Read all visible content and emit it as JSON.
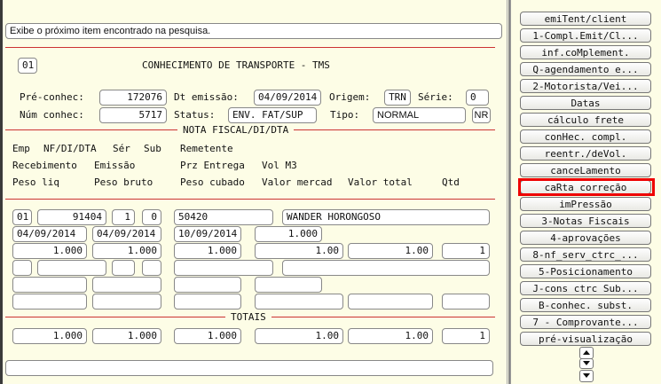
{
  "status_hint": "Exibe o próximo item encontrado na pesquisa.",
  "header": {
    "code": "01",
    "title": "CONHECIMENTO DE TRANSPORTE - TMS"
  },
  "doc": {
    "pre_conhec_label": "Pré-conhec:",
    "pre_conhec": "172076",
    "dt_emissao_label": "Dt emissão:",
    "dt_emissao": "04/09/2014",
    "origem_label": "Origem:",
    "origem": "TRN",
    "serie_label": "Série:",
    "serie": "0",
    "num_conhec_label": "Núm conhec:",
    "num_conhec": "5717",
    "status_label": "Status:",
    "status": "ENV. FAT/SUP",
    "tipo_label": "Tipo:",
    "tipo": "NORMAL",
    "tipo_code": "NR"
  },
  "nf_section": {
    "title": "NOTA FISCAL/DI/DTA",
    "headers_row1": [
      "Emp",
      "NF/DI/DTA",
      "Sér",
      "Sub",
      "Remetente"
    ],
    "headers_row2": [
      "Recebimento",
      "Emissão",
      "Prz Entrega",
      "Vol M3"
    ],
    "headers_row3": [
      "Peso liq",
      "Peso bruto",
      "Peso cubado",
      "Valor mercad",
      "Valor total",
      "Qtd"
    ],
    "row1": {
      "emp": "01",
      "nf": "91404",
      "ser": "1",
      "sub": "0",
      "rem_code": "50420",
      "rem_name": "WANDER HORONGOSO"
    },
    "row2": {
      "recebimento": "04/09/2014",
      "emissao": "04/09/2014",
      "prz_entrega": "10/09/2014",
      "vol_m3": "1.000"
    },
    "row3": {
      "peso_liq": "1.000",
      "peso_bruto": "1.000",
      "peso_cubado": "1.000",
      "valor_mercad": "1.00",
      "valor_total": "1.00",
      "qtd": "1"
    }
  },
  "totais": {
    "title": "TOTAIS",
    "values": [
      "1.000",
      "1.000",
      "1.000",
      "1.00",
      "1.00",
      "1"
    ]
  },
  "side_menu": [
    "emiTent/client",
    "1-Compl.Emit/Cl...",
    "inf.coMplement.",
    "Q-agendamento e...",
    "2-Motorista/Vei...",
    "Datas",
    "cálculo frete",
    "conHec. compl.",
    "reentr./deVol.",
    "canceLamento",
    "caRta correção",
    "imPressão",
    "3-Notas Fiscais",
    "4-aprovações",
    "8-nf_serv_ctrc_...",
    "5-Posicionamento",
    "J-cons ctrc Sub...",
    "B-conhec. subst.",
    "7 - Comprovante...",
    "pré-visualização"
  ],
  "selected_menu_index": 10,
  "colors": {
    "accent_red": "#e00000",
    "divider": "#cc3333",
    "background": "#fdfde6"
  },
  "icons": {
    "scroll_up": "triangle-up",
    "scroll_down": "triangle-down"
  }
}
